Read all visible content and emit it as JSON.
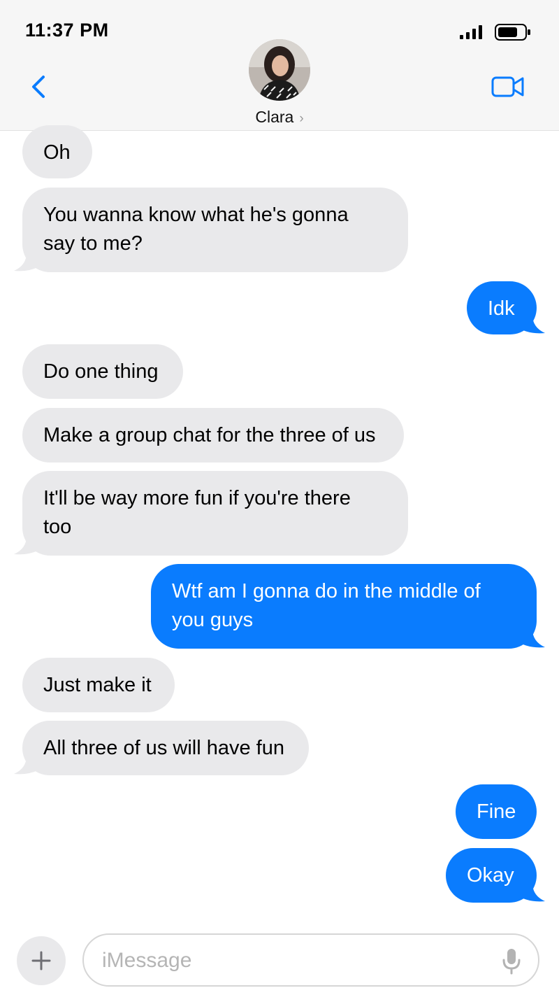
{
  "status_bar": {
    "time": "11:37 PM"
  },
  "header": {
    "contact_name": "Clara",
    "chevron": "›",
    "icons": {
      "back": "chevron-left-icon",
      "video": "video-camera-icon"
    },
    "accent_color": "#0a7cfe"
  },
  "messages": [
    {
      "side": "received",
      "text": "Oh"
    },
    {
      "side": "received",
      "text": "You wanna know what he's gonna\nsay to me?"
    },
    {
      "side": "sent",
      "text": "Idk"
    },
    {
      "side": "received",
      "text": "Do one thing"
    },
    {
      "side": "received",
      "text": "Make a group chat for the three of us"
    },
    {
      "side": "received",
      "text": "It'll be way more fun if you're there\ntoo"
    },
    {
      "side": "sent",
      "text": "Wtf am I gonna do in the middle of\nyou guys"
    },
    {
      "side": "received",
      "text": "Just make it"
    },
    {
      "side": "received",
      "text": "All three of us will have fun"
    },
    {
      "side": "sent",
      "text": "Fine"
    },
    {
      "side": "sent",
      "text": "Okay"
    }
  ],
  "composer": {
    "placeholder": "iMessage",
    "value": "",
    "icons": {
      "add": "plus-icon",
      "mic": "microphone-icon"
    }
  },
  "colors": {
    "sent_bubble": "#0a7cfe",
    "received_bubble": "#e9e9eb"
  }
}
